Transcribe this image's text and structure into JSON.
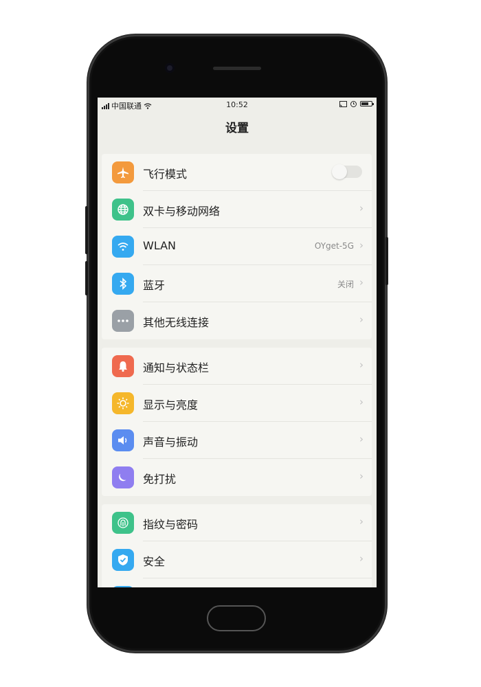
{
  "status_bar": {
    "carrier": "中国联通",
    "time": "10:52"
  },
  "page": {
    "title": "设置"
  },
  "groups": [
    {
      "items": [
        {
          "label": "飞行模式",
          "icon": "airplane-icon",
          "color": "#f39a3d",
          "control": "toggle",
          "toggle_on": false
        },
        {
          "label": "双卡与移动网络",
          "icon": "globe-icon",
          "color": "#3ec28a",
          "control": "chevron"
        },
        {
          "label": "WLAN",
          "value": "OYget-5G",
          "icon": "wifi-icon",
          "color": "#35a9f0",
          "control": "chevron"
        },
        {
          "label": "蓝牙",
          "value": "关闭",
          "icon": "bluetooth-icon",
          "color": "#35a9f0",
          "control": "chevron"
        },
        {
          "label": "其他无线连接",
          "icon": "more-dots-icon",
          "color": "#9aa0a6",
          "control": "chevron"
        }
      ]
    },
    {
      "items": [
        {
          "label": "通知与状态栏",
          "icon": "bell-icon",
          "color": "#ef6a4f",
          "control": "chevron"
        },
        {
          "label": "显示与亮度",
          "icon": "sun-icon",
          "color": "#f5b72b",
          "control": "chevron"
        },
        {
          "label": "声音与振动",
          "icon": "speaker-icon",
          "color": "#5b8df0",
          "control": "chevron"
        },
        {
          "label": "免打扰",
          "icon": "moon-icon",
          "color": "#8f7ef0",
          "control": "chevron"
        }
      ]
    },
    {
      "items": [
        {
          "label": "指纹与密码",
          "icon": "fingerprint-icon",
          "color": "#3ec28a",
          "control": "chevron"
        },
        {
          "label": "安全",
          "icon": "shield-icon",
          "color": "#35a9f0",
          "control": "chevron"
        }
      ]
    }
  ],
  "chevron_glyph": "›"
}
